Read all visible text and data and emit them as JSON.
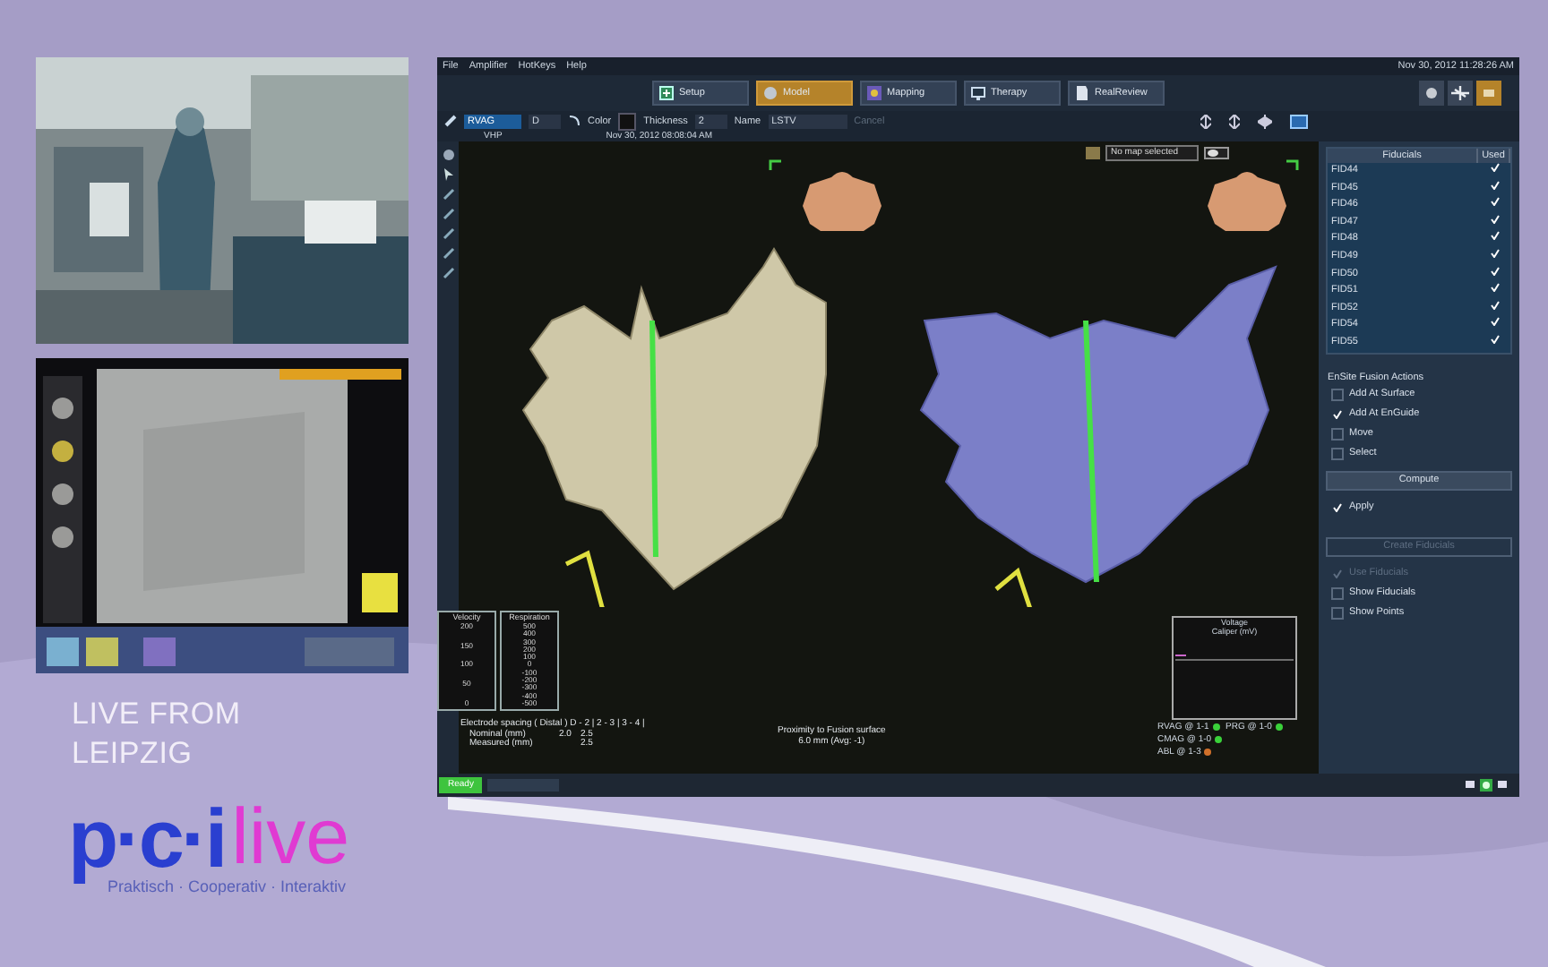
{
  "broadcast": {
    "camera_feed": {
      "kind": "picture"
    },
    "fluoro_feed": {
      "kind": "picture"
    },
    "caption_lines": [
      "LIVE FROM",
      "LEIPZIG"
    ],
    "logo": {
      "left": "p·c·i",
      "right": "live",
      "tagline": "Praktisch · Cooperativ · Interaktiv"
    }
  },
  "window": {
    "menu": [
      "File",
      "Amplifier",
      "HotKeys",
      "Help"
    ],
    "datetime": "Nov 30, 2012 11:28:26 AM",
    "tabs": [
      {
        "label": "Setup",
        "selected": false
      },
      {
        "label": "Model",
        "selected": true
      },
      {
        "label": "Mapping",
        "selected": false
      },
      {
        "label": "Therapy",
        "selected": false
      },
      {
        "label": "RealReview",
        "selected": false
      }
    ],
    "view_buttons": [
      {
        "selected": false
      },
      {
        "selected": false
      },
      {
        "selected": true
      }
    ],
    "toolbar": {
      "catheter": "RVAG",
      "electrode": "D",
      "color_label": "Color",
      "thickness_label": "Thickness",
      "thickness": "2",
      "name_label": "Name",
      "name": "LSTV",
      "cancel": {
        "label": "Cancel",
        "disabled": true
      }
    },
    "view_label": "VHP",
    "view_datetime": "Nov 30, 2012 08:08:04 AM",
    "map_select": "No map selected",
    "velocity": {
      "title": "Velocity",
      "ticks": [
        "200",
        "150",
        "100",
        "50",
        "0"
      ]
    },
    "respiration": {
      "title": "Respiration",
      "ticks": [
        "500",
        "400",
        "300",
        "200",
        "100",
        "0",
        "-100",
        "-200",
        "-300",
        "-400",
        "-500"
      ]
    },
    "spacing": {
      "header": "Electrode spacing ( Distal ) D - 2 | 2 - 3 | 3 - 4 |",
      "rows": [
        {
          "label": "Nominal (mm)",
          "d_2": "2.0",
          "s_2_3": "2.5"
        },
        {
          "label": "Measured (mm)",
          "s_2_3": "2.5"
        }
      ]
    },
    "proximity": {
      "title": "Proximity to Fusion surface",
      "value": "6.0 mm (Avg: -1)"
    },
    "voltage": {
      "title": "Voltage",
      "subtitle": "Caliper (mV)"
    },
    "catheter_status": [
      {
        "label": "RVAG @ 1-1",
        "color": "#3ad13a"
      },
      {
        "label": "PRG @ 1-0",
        "color": "#3ad13a"
      },
      {
        "label": "CMAG @ 1-0",
        "color": "#3ad13a"
      },
      {
        "label": "ABL @ 1-3",
        "color": "#d0702a"
      }
    ],
    "fiducials": {
      "header": "Fiducials",
      "used_header": "Used",
      "rows": [
        {
          "name": "FID44",
          "used": true
        },
        {
          "name": "FID45",
          "used": true
        },
        {
          "name": "FID46",
          "used": true
        },
        {
          "name": "FID47",
          "used": true
        },
        {
          "name": "FID48",
          "used": true
        },
        {
          "name": "FID49",
          "used": true
        },
        {
          "name": "FID50",
          "used": true
        },
        {
          "name": "FID51",
          "used": true
        },
        {
          "name": "FID52",
          "used": true
        },
        {
          "name": "FID54",
          "used": true
        },
        {
          "name": "FID55",
          "used": true
        }
      ]
    },
    "fusion_actions": {
      "title": "EnSite Fusion Actions",
      "options": [
        {
          "label": "Add At Surface",
          "checked": false
        },
        {
          "label": "Add At EnGuide",
          "checked": true
        },
        {
          "label": "Move",
          "checked": false
        },
        {
          "label": "Select",
          "checked": false
        }
      ]
    },
    "compute": "Compute",
    "apply": {
      "label": "Apply",
      "checked": true
    },
    "create_fiducials": {
      "label": "Create Fiducials",
      "disabled": true
    },
    "display_options": [
      {
        "label": "Use Fiducials",
        "checked": true,
        "disabled": true
      },
      {
        "label": "Show Fiducials",
        "checked": false,
        "disabled": false
      },
      {
        "label": "Show Points",
        "checked": false,
        "disabled": false
      }
    ],
    "status_button": "Ready"
  }
}
